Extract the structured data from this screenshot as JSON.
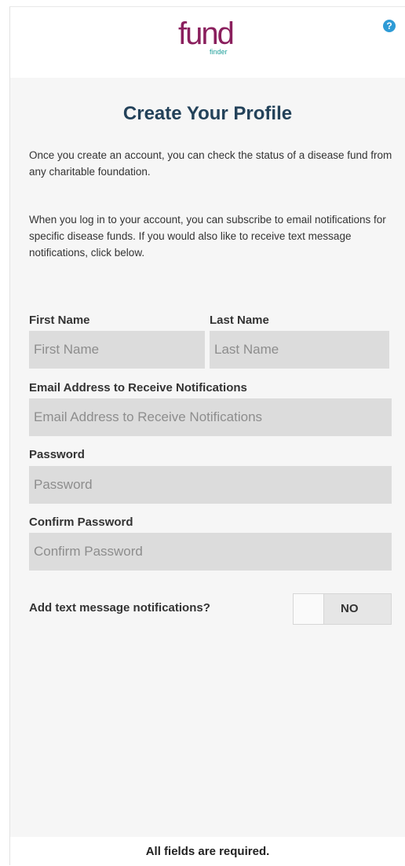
{
  "header": {
    "logo_main": "fund",
    "logo_sub": "finder",
    "help_icon": "question-circle-icon",
    "help_glyph": "?"
  },
  "page": {
    "title": "Create Your Profile",
    "intro_1": "Once you create an account, you can check the status of a disease fund from any charitable foundation.",
    "intro_2": "When you log in to your account, you can subscribe to email notifications for specific disease funds. If you would also like to receive text message notifications, click below."
  },
  "form": {
    "first_name": {
      "label": "First Name",
      "placeholder": "First Name",
      "value": ""
    },
    "last_name": {
      "label": "Last Name",
      "placeholder": "Last Name",
      "value": ""
    },
    "email": {
      "label": "Email Address to Receive Notifications",
      "placeholder": "Email Address to Receive Notifications",
      "value": ""
    },
    "password": {
      "label": "Password",
      "placeholder": "Password",
      "value": ""
    },
    "confirm_password": {
      "label": "Confirm Password",
      "placeholder": "Confirm Password",
      "value": ""
    },
    "text_notifications": {
      "label": "Add text message notifications?",
      "state": "NO"
    }
  },
  "footer": {
    "note": "All fields are required."
  },
  "colors": {
    "brand_magenta": "#8a1f5d",
    "brand_teal": "#1e9f9a",
    "title": "#23425a",
    "field_bg": "#dcdcdc",
    "help_blue": "#2e9bd6"
  }
}
